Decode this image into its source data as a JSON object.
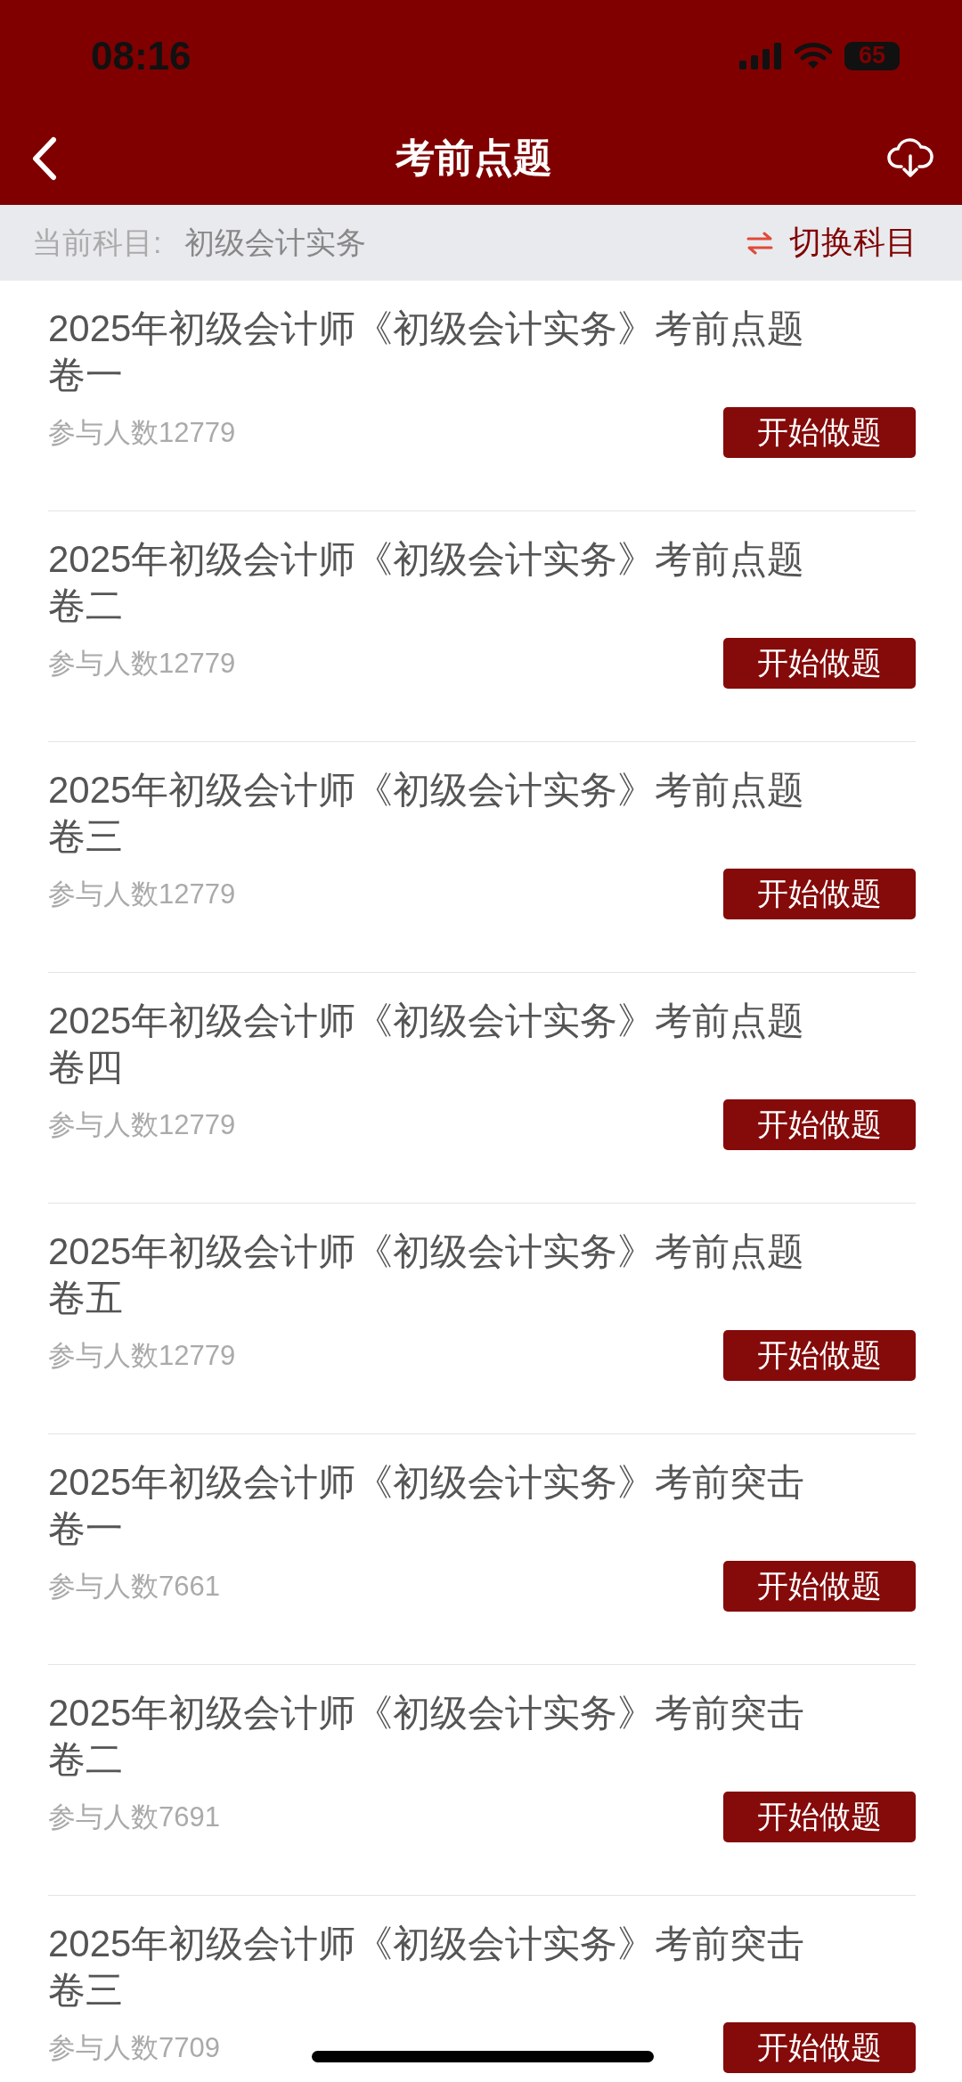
{
  "status_bar": {
    "time": "08:16",
    "battery": "65"
  },
  "nav_bar": {
    "title": "考前点题"
  },
  "subject_bar": {
    "label": "当前科目:",
    "subject": "初级会计实务",
    "switch_label": "切换科目"
  },
  "papers": [
    {
      "title": "2025年初级会计师《初级会计实务》考前点题卷一",
      "participants": "参与人数12779",
      "button": "开始做题"
    },
    {
      "title": "2025年初级会计师《初级会计实务》考前点题卷二",
      "participants": "参与人数12779",
      "button": "开始做题"
    },
    {
      "title": "2025年初级会计师《初级会计实务》考前点题卷三",
      "participants": "参与人数12779",
      "button": "开始做题"
    },
    {
      "title": "2025年初级会计师《初级会计实务》考前点题卷四",
      "participants": "参与人数12779",
      "button": "开始做题"
    },
    {
      "title": "2025年初级会计师《初级会计实务》考前点题卷五",
      "participants": "参与人数12779",
      "button": "开始做题"
    },
    {
      "title": "2025年初级会计师《初级会计实务》考前突击卷一",
      "participants": "参与人数7661",
      "button": "开始做题"
    },
    {
      "title": "2025年初级会计师《初级会计实务》考前突击卷二",
      "participants": "参与人数7691",
      "button": "开始做题"
    },
    {
      "title": "2025年初级会计师《初级会计实务》考前突击卷三",
      "participants": "参与人数7709",
      "button": "开始做题"
    }
  ]
}
